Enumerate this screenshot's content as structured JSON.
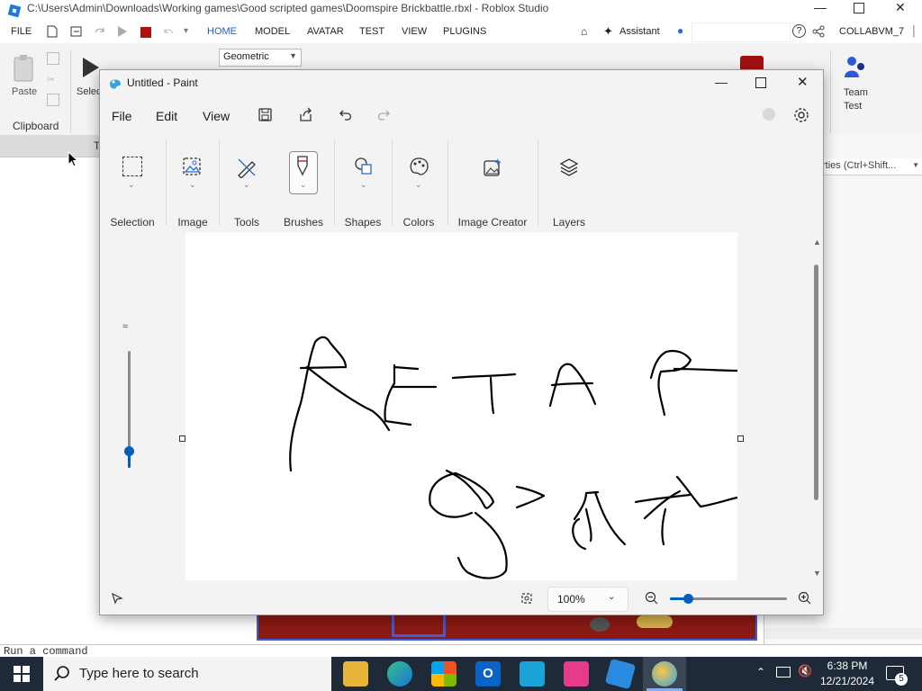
{
  "studio": {
    "title": "C:\\Users\\Admin\\Downloads\\Working games\\Good scripted games\\Doomspire Brickbattle.rbxl - Roblox Studio",
    "menu": [
      "FILE",
      "HOME",
      "MODEL",
      "AVATAR",
      "TEST",
      "VIEW",
      "PLUGINS"
    ],
    "assistant": "Assistant",
    "user": "COLLABVM_7",
    "ribbon": {
      "paste": "Paste",
      "clipboard": "Clipboard",
      "select": "Selec",
      "geometric": "Geometric",
      "team_test": "Team\nTest"
    },
    "properties_title": "perties",
    "properties_filter": "rties (Ctrl+Shift...",
    "explorer_tab": "T",
    "command_placeholder": "Run a command"
  },
  "paint": {
    "title": "Untitled - Paint",
    "menu": {
      "file": "File",
      "edit": "Edit",
      "view": "View"
    },
    "tools": {
      "selection": "Selection",
      "image": "Image",
      "tools": "Tools",
      "brushes": "Brushes",
      "shapes": "Shapes",
      "colors": "Colors",
      "image_creator": "Image Creator",
      "layers": "Layers"
    },
    "zoom": "100%",
    "brush_size_fraction": 0.15
  },
  "taskbar": {
    "search_placeholder": "Type here to search",
    "time": "6:38 PM",
    "date": "12/21/2024",
    "notifications": "5"
  },
  "colors": {
    "accent": "#005fb8",
    "taskbar": "#1e2a38",
    "viewport": "#8b1a14",
    "stop_red": "#c01818"
  }
}
